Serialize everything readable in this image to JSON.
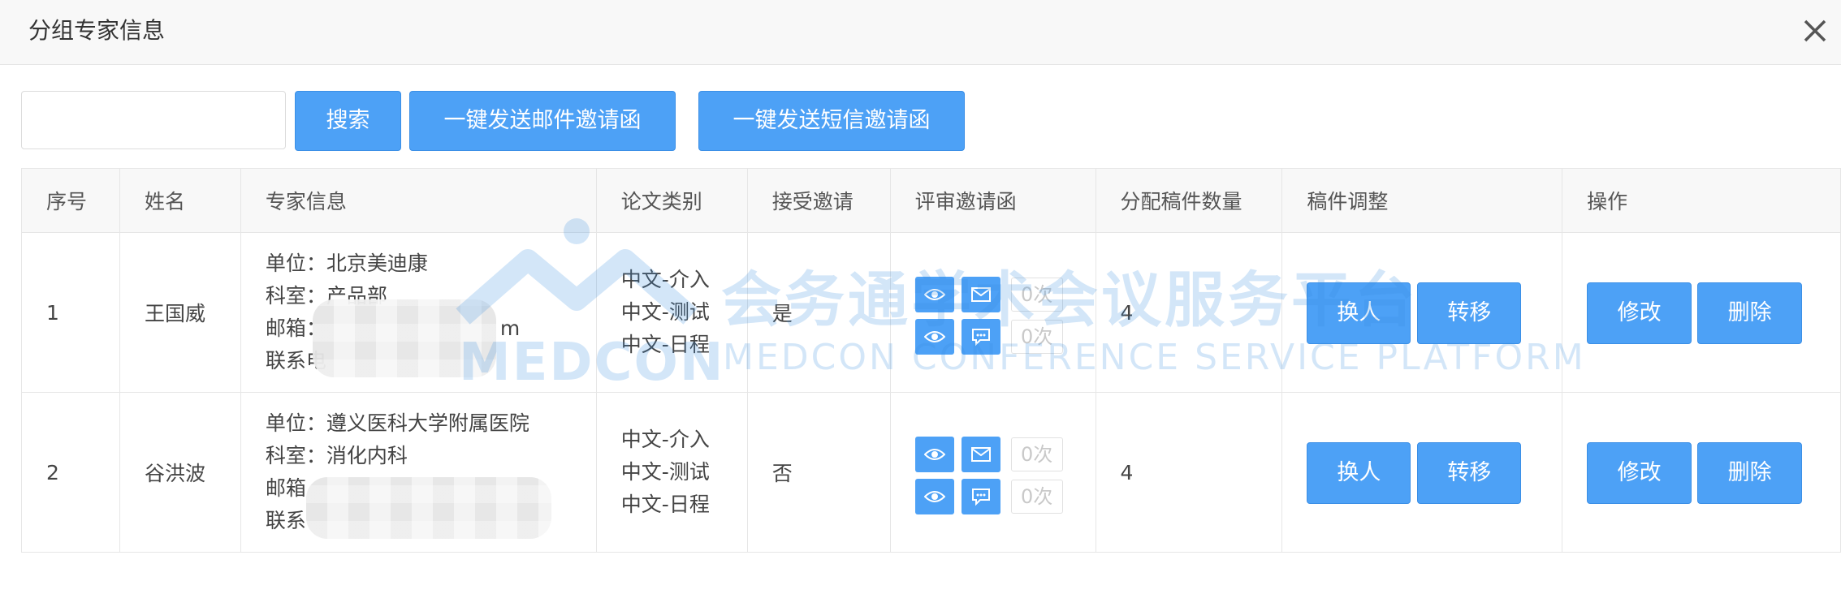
{
  "dialog": {
    "title": "分组专家信息"
  },
  "toolbar": {
    "search_value": "",
    "search_label": "搜索",
    "email_invite_label": "一键发送邮件邀请函",
    "sms_invite_label": "一键发送短信邀请函"
  },
  "table": {
    "headers": [
      "序号",
      "姓名",
      "专家信息",
      "论文类别",
      "接受邀请",
      "评审邀请函",
      "分配稿件数量",
      "稿件调整",
      "操作"
    ],
    "rows": [
      {
        "index": "1",
        "name": "王国威",
        "unit": "单位：北京美迪康",
        "dept": "科室：产品部",
        "email": "邮箱：",
        "email_tail": "m",
        "phone": "联系电",
        "categories": [
          "中文-介入",
          "中文-测试",
          "中文-日程"
        ],
        "accepted": "是",
        "email_count": "0次",
        "sms_count": "0次",
        "manuscripts": "4"
      },
      {
        "index": "2",
        "name": "谷洪波",
        "unit": "单位：遵义医科大学附属医院",
        "dept": "科室：消化内科",
        "email": "邮箱",
        "email_tail": "",
        "phone": "联系",
        "categories": [
          "中文-介入",
          "中文-测试",
          "中文-日程"
        ],
        "accepted": "否",
        "email_count": "0次",
        "sms_count": "0次",
        "manuscripts": "4"
      }
    ]
  },
  "row_actions": {
    "replace_label": "换人",
    "transfer_label": "转移",
    "edit_label": "修改",
    "delete_label": "删除"
  },
  "icons": {
    "close": "close-icon",
    "view": "eye-icon",
    "email": "mail-icon",
    "sms": "message-icon"
  },
  "watermark": {
    "cn": "会务通学术会议服务平台",
    "logo": "MEDCON",
    "en": "MEDCON CONFERENCE SERVICE PLATFORM"
  },
  "colors": {
    "primary": "#4da1f6",
    "header_bg": "#f8f8f8",
    "border": "#e6e6e6"
  }
}
